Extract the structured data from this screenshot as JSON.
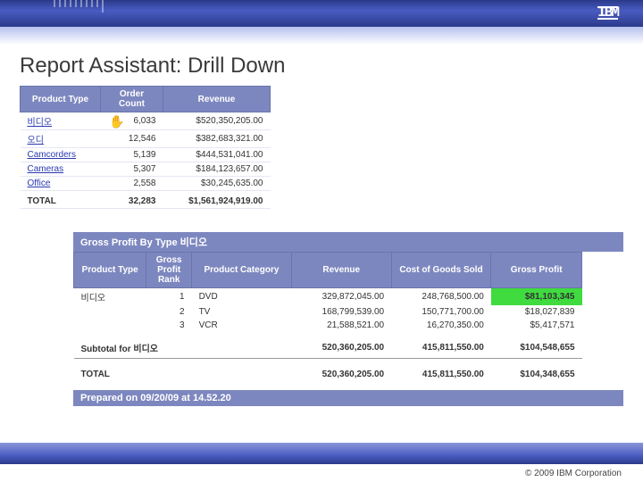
{
  "page": {
    "title": "Report Assistant: Drill Down",
    "copyright": "© 2009 IBM Corporation"
  },
  "table1": {
    "headers": {
      "type": "Product Type",
      "count": "Order Count",
      "rev": "Revenue"
    },
    "rows": [
      {
        "type": "비디오",
        "count": "6,033",
        "rev": "$520,350,205.00"
      },
      {
        "type": "오디",
        "count": "12,546",
        "rev": "$382,683,321.00"
      },
      {
        "type": "Camcorders",
        "count": "5,139",
        "rev": "$444,531,041.00"
      },
      {
        "type": "Cameras",
        "count": "5,307",
        "rev": "$184,123,657.00"
      },
      {
        "type": "Office",
        "count": "2,558",
        "rev": "$30,245,635.00"
      }
    ],
    "total": {
      "label": "TOTAL",
      "count": "32,283",
      "rev": "$1,561,924,919.00"
    }
  },
  "table2": {
    "title": "Gross Profit By Type 비디오",
    "headers": {
      "type": "Product Type",
      "rank": "Gross Profit Rank",
      "cat": "Product Category",
      "rev": "Revenue",
      "cogs": "Cost of Goods Sold",
      "gp": "Gross Profit"
    },
    "group": "비디오",
    "rows": [
      {
        "rank": "1",
        "cat": "DVD",
        "rev": "329,872,045.00",
        "cogs": "248,768,500.00",
        "gp": "$81,103,345"
      },
      {
        "rank": "2",
        "cat": "TV",
        "rev": "168,799,539.00",
        "cogs": "150,771,700.00",
        "gp": "$18,027,839"
      },
      {
        "rank": "3",
        "cat": "VCR",
        "rev": "21,588,521.00",
        "cogs": "16,270,350.00",
        "gp": "$5,417,571"
      }
    ],
    "subtotal": {
      "label": "Subtotal for 비디오",
      "rev": "520,360,205.00",
      "cogs": "415,811,550.00",
      "gp": "$104,548,655"
    },
    "total": {
      "label": "TOTAL",
      "rev": "520,360,205.00",
      "cogs": "415,811,550.00",
      "gp": "$104,348,655"
    },
    "prepared": "Prepared on 09/20/09 at 14.52.20"
  }
}
